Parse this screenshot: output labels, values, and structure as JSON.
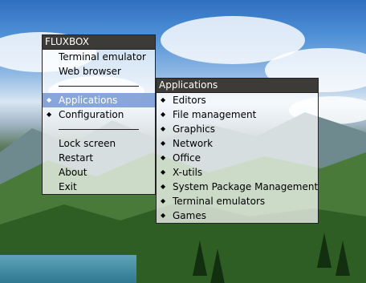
{
  "main_menu": {
    "title": "FLUXBOX",
    "items": [
      {
        "label": "Terminal emulator"
      },
      {
        "label": "Web browser"
      },
      {
        "label": "Applications",
        "submenu": true,
        "active": true
      },
      {
        "label": "Configuration",
        "submenu": true
      },
      {
        "label": "Lock screen"
      },
      {
        "label": "Restart"
      },
      {
        "label": "About"
      },
      {
        "label": "Exit"
      }
    ]
  },
  "applications_menu": {
    "title": "Applications",
    "items": [
      {
        "label": "Editors"
      },
      {
        "label": "File management"
      },
      {
        "label": "Graphics"
      },
      {
        "label": "Network"
      },
      {
        "label": "Office"
      },
      {
        "label": "X-utils"
      },
      {
        "label": "System Package Management"
      },
      {
        "label": "Terminal emulators"
      },
      {
        "label": "Games"
      }
    ]
  },
  "colors": {
    "title_bar": "#3c3b37",
    "highlight": "#7396d2",
    "menu_background": "rgba(255,255,255,0.72)"
  },
  "icons": {
    "submenu_marker": "diamond-bullet-icon"
  }
}
